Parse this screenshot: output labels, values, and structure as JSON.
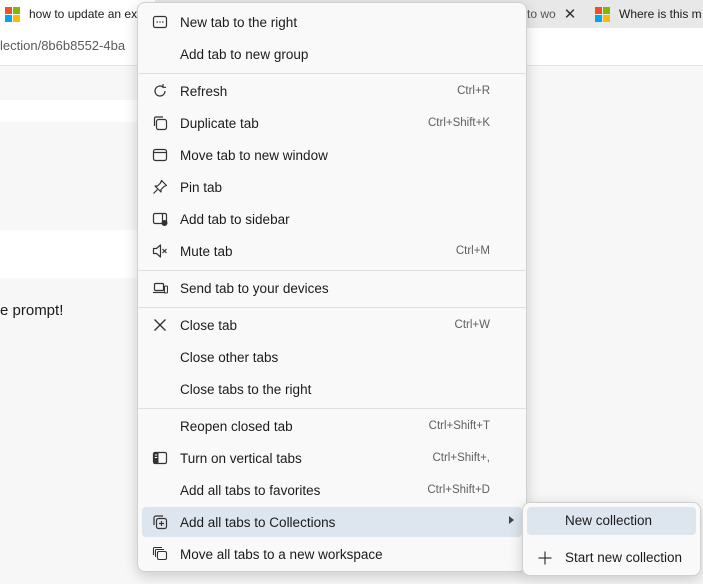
{
  "browser": {
    "tabs": [
      {
        "title": "how to update an ex",
        "active": true
      },
      {
        "title": "to wo",
        "close": "✕"
      },
      {
        "title": "Where is this m"
      }
    ],
    "address": "lection/8b6b8552-4ba",
    "page_text": "e prompt!"
  },
  "menu": {
    "items": [
      {
        "label": "New tab to the right",
        "shortcut": "",
        "icon": "new-tab-icon"
      },
      {
        "label": "Add tab to new group",
        "shortcut": "",
        "icon": ""
      },
      {
        "label": "Refresh",
        "shortcut": "Ctrl+R",
        "icon": "refresh-icon"
      },
      {
        "label": "Duplicate tab",
        "shortcut": "Ctrl+Shift+K",
        "icon": "duplicate-icon"
      },
      {
        "label": "Move tab to new window",
        "shortcut": "",
        "icon": "window-icon"
      },
      {
        "label": "Pin tab",
        "shortcut": "",
        "icon": "pin-icon"
      },
      {
        "label": "Add tab to sidebar",
        "shortcut": "",
        "icon": "sidebar-icon"
      },
      {
        "label": "Mute tab",
        "shortcut": "Ctrl+M",
        "icon": "mute-icon"
      },
      {
        "label": "Send tab to your devices",
        "shortcut": "",
        "icon": "devices-icon"
      },
      {
        "label": "Close tab",
        "shortcut": "Ctrl+W",
        "icon": "close-icon"
      },
      {
        "label": "Close other tabs",
        "shortcut": "",
        "icon": ""
      },
      {
        "label": "Close tabs to the right",
        "shortcut": "",
        "icon": ""
      },
      {
        "label": "Reopen closed tab",
        "shortcut": "Ctrl+Shift+T",
        "icon": ""
      },
      {
        "label": "Turn on vertical tabs",
        "shortcut": "Ctrl+Shift+,",
        "icon": "vertical-tabs-icon"
      },
      {
        "label": "Add all tabs to favorites",
        "shortcut": "Ctrl+Shift+D",
        "icon": ""
      },
      {
        "label": "Add all tabs to Collections",
        "shortcut": "",
        "icon": "collections-icon"
      },
      {
        "label": "Move all tabs to a new workspace",
        "shortcut": "",
        "icon": "workspace-icon"
      }
    ]
  },
  "submenu": {
    "items": [
      {
        "label": "New collection",
        "icon": ""
      },
      {
        "label": "Start new collection",
        "icon": "plus-icon"
      }
    ]
  },
  "colors": {
    "hover": "#dde5ee",
    "ms_red": "#f25022",
    "ms_green": "#7fba00",
    "ms_blue": "#00a4ef",
    "ms_yellow": "#ffb900"
  }
}
